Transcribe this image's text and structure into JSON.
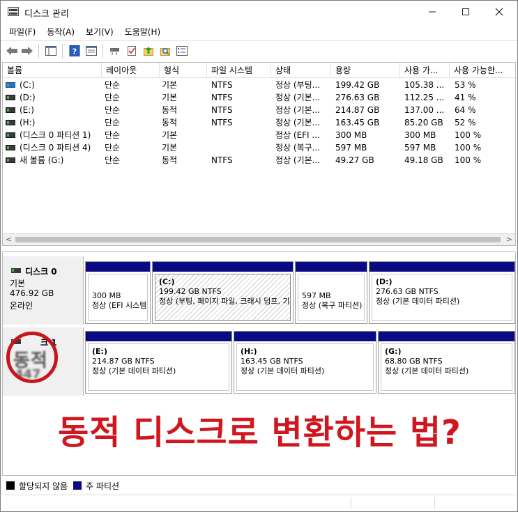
{
  "window": {
    "title": "디스크 관리",
    "controls": {
      "minimize": "—",
      "maximize": "☐",
      "close": "✕"
    }
  },
  "menu": [
    "파일(F)",
    "동작(A)",
    "보기(V)",
    "도움말(H)"
  ],
  "volume_table": {
    "columns": [
      "볼륨",
      "레이아웃",
      "형식",
      "파일 시스템",
      "상태",
      "용량",
      "사용 가...",
      "사용 가능한..."
    ],
    "rows": [
      {
        "volume": "(C:)",
        "layout": "단순",
        "type": "기본",
        "fs": "NTFS",
        "status": "정상 (부팅...",
        "capacity": "199.42 GB",
        "free": "105.38 ...",
        "pct": "53 %",
        "system": true
      },
      {
        "volume": "(D:)",
        "layout": "단순",
        "type": "기본",
        "fs": "NTFS",
        "status": "정상 (기본...",
        "capacity": "276.63 GB",
        "free": "112.25 ...",
        "pct": "41 %",
        "system": false
      },
      {
        "volume": "(E:)",
        "layout": "단순",
        "type": "동적",
        "fs": "NTFS",
        "status": "정상 (기본...",
        "capacity": "214.87 GB",
        "free": "137.00 ...",
        "pct": "64 %",
        "system": false
      },
      {
        "volume": "(H:)",
        "layout": "단순",
        "type": "동적",
        "fs": "NTFS",
        "status": "정상 (기본...",
        "capacity": "163.45 GB",
        "free": "85.20 GB",
        "pct": "52 %",
        "system": false
      },
      {
        "volume": "(디스크 0 파티션 1)",
        "layout": "단순",
        "type": "기본",
        "fs": "",
        "status": "정상 (EFI ...",
        "capacity": "300 MB",
        "free": "300 MB",
        "pct": "100 %",
        "system": false
      },
      {
        "volume": "(디스크 0 파티션 4)",
        "layout": "단순",
        "type": "기본",
        "fs": "",
        "status": "정상 (복구...",
        "capacity": "597 MB",
        "free": "597 MB",
        "pct": "100 %",
        "system": false
      },
      {
        "volume": "새 볼륨 (G:)",
        "layout": "단순",
        "type": "동적",
        "fs": "NTFS",
        "status": "정상 (기본...",
        "capacity": "49.27 GB",
        "free": "49.18 GB",
        "pct": "100 %",
        "system": false
      }
    ]
  },
  "disks": [
    {
      "name": "디스크 0",
      "kind": "기본",
      "size": "476.92 GB",
      "state": "온라인",
      "partitions": [
        {
          "name": "",
          "size": "300 MB",
          "status": "정상 (EFI 시스템 파티션)"
        },
        {
          "name": "(C:)",
          "size": "199.42 GB NTFS",
          "status": "정상 (부팅, 페이지 파일, 크래시 덤프, 기본 데이터 파티션)"
        },
        {
          "name": "",
          "size": "597 MB",
          "status": "정상 (복구 파티션)"
        },
        {
          "name": "(D:)",
          "size": "276.63 GB NTFS",
          "status": "정상 (기본 데이터 파티션)"
        }
      ]
    },
    {
      "name": "크 1",
      "kind": "동적",
      "size": "447",
      "partitions": [
        {
          "name": "(E:)",
          "size": "214.87 GB NTFS",
          "status": "정상 (기본 데이터 파티션)"
        },
        {
          "name": "(H:)",
          "size": "163.45 GB NTFS",
          "status": "정상 (기본 데이터 파티션)"
        },
        {
          "name": "(G:)",
          "size": "68.80 GB NTFS",
          "status": "정상 (기본 데이터 파티션)"
        }
      ]
    }
  ],
  "headline": "동적 디스크로 변환하는 법?",
  "legend": [
    {
      "label": "할당되지 않음",
      "color": "#000000"
    },
    {
      "label": "주 파티션",
      "color": "#0a0a82"
    }
  ],
  "colors": {
    "accent_red": "#d0161e",
    "partition_bar": "#0a0a82"
  }
}
